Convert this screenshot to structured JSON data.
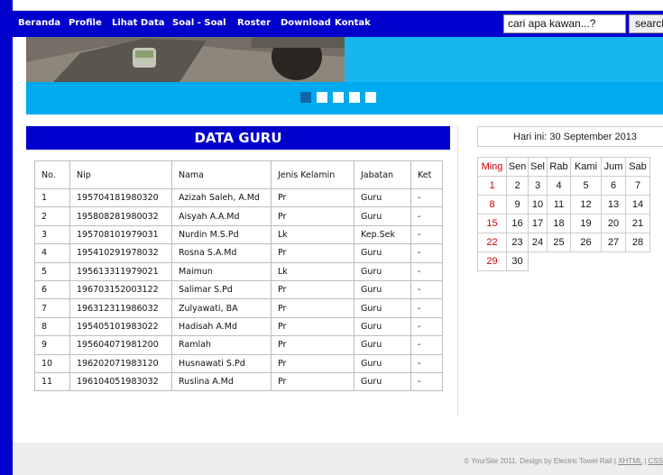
{
  "nav": {
    "items": [
      "Beranda",
      "Profile",
      "Lihat Data",
      "Soal - Soal",
      "Roster",
      "Download",
      "Kontak"
    ]
  },
  "search": {
    "value": "cari apa kawan...?",
    "button_label": "search"
  },
  "banner": {
    "slides": 5,
    "active_index": 0
  },
  "data_guru": {
    "title": "DATA GURU",
    "columns": [
      "No.",
      "Nip",
      "Nama",
      "Jenis Kelamin",
      "Jabatan",
      "Ket"
    ],
    "rows": [
      [
        "1",
        "195704181980320",
        "Azizah Saleh, A.Md",
        "Pr",
        "Guru",
        "-"
      ],
      [
        "2",
        "195808281980032",
        "Aisyah A.A.Md",
        "Pr",
        "Guru",
        "-"
      ],
      [
        "3",
        "195708101979031",
        "Nurdin M.S.Pd",
        "Lk",
        "Kep.Sek",
        "-"
      ],
      [
        "4",
        "195410291978032",
        "Rosna S.A.Md",
        "Pr",
        "Guru",
        "-"
      ],
      [
        "5",
        "195613311979021",
        "Maimun",
        "Lk",
        "Guru",
        "-"
      ],
      [
        "6",
        "196703152003122",
        "Salimar S.Pd",
        "Pr",
        "Guru",
        "-"
      ],
      [
        "7",
        "196312311986032",
        "Zulyawati, BA",
        "Pr",
        "Guru",
        "-"
      ],
      [
        "8",
        "195405101983022",
        "Hadisah A.Md",
        "Pr",
        "Guru",
        "-"
      ],
      [
        "9",
        "195604071981200",
        "Ramlah",
        "Pr",
        "Guru",
        "-"
      ],
      [
        "10",
        "196202071983120",
        "Husnawati S.Pd",
        "Pr",
        "Guru",
        "-"
      ],
      [
        "11",
        "196104051983032",
        "Ruslina A.Md",
        "Pr",
        "Guru",
        "-"
      ]
    ]
  },
  "calendar": {
    "today_label": "Hari ini: 30 September 2013",
    "weekdays": [
      "Ming",
      "Sen",
      "Sel",
      "Rab",
      "Kami",
      "Jum",
      "Sab"
    ],
    "weeks": [
      [
        "1",
        "2",
        "3",
        "4",
        "5",
        "6",
        "7"
      ],
      [
        "8",
        "9",
        "10",
        "11",
        "12",
        "13",
        "14"
      ],
      [
        "15",
        "16",
        "17",
        "18",
        "19",
        "20",
        "21"
      ],
      [
        "22",
        "23",
        "24",
        "25",
        "26",
        "27",
        "28"
      ],
      [
        "29",
        "30",
        "",
        "",
        "",
        "",
        ""
      ]
    ],
    "sunday_color": "#cc0000"
  },
  "footer": {
    "text": "© YourSite 2011. Design by Electric Towel Rail | ",
    "link_xhtml": "XHTML",
    "separator": " | ",
    "link_css": "CSS"
  },
  "colors": {
    "nav_bg": "#0000cc",
    "banner_bg": "#00aaee",
    "title_bg": "#0000cc"
  }
}
